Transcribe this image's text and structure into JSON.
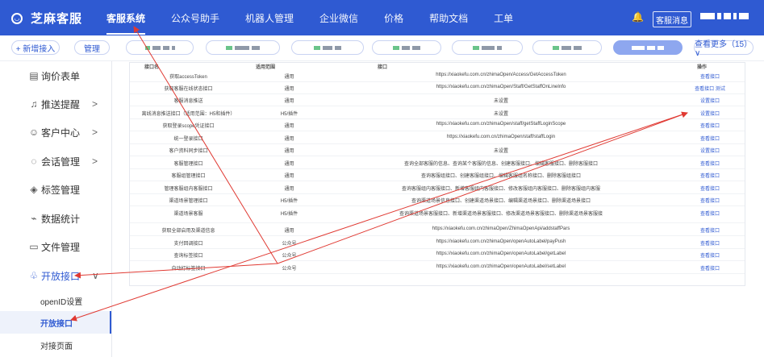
{
  "topbar": {
    "logo_glyph": "◡",
    "title": "芝麻客服",
    "nav": [
      "客服系统",
      "公众号助手",
      "机器人管理",
      "企业微信",
      "价格",
      "帮助文档",
      "工单"
    ],
    "bell_glyph": "🔔",
    "kf_button": "客服消息",
    "colors": {
      "brand": "#2f5ad2"
    }
  },
  "chipbar": {
    "add": "+ 新增接入",
    "manage": "管理",
    "more": "查看更多（15） ∨"
  },
  "sidebar": {
    "items": [
      {
        "label": "询价表单",
        "icon": "form-icon",
        "glyph": "▤",
        "arrow": ""
      },
      {
        "label": "推送提醒",
        "icon": "bell-icon",
        "glyph": "♫",
        "arrow": ">"
      },
      {
        "label": "客户中心",
        "icon": "user-icon",
        "glyph": "☺",
        "arrow": ">"
      },
      {
        "label": "会话管理",
        "icon": "chat-icon",
        "glyph": "◌",
        "arrow": ">"
      },
      {
        "label": "标签管理",
        "icon": "tag-icon",
        "glyph": "◈",
        "arrow": ""
      },
      {
        "label": "数据统计",
        "icon": "chart-icon",
        "glyph": "⌁",
        "arrow": ""
      },
      {
        "label": "文件管理",
        "icon": "folder-icon",
        "glyph": "▭",
        "arrow": ""
      },
      {
        "label": "开放接口",
        "icon": "api-icon",
        "glyph": "♧",
        "arrow": "∨"
      }
    ],
    "sub": [
      "openID设置",
      "开放接口",
      "对接页面"
    ]
  },
  "table": {
    "headers": [
      "接口名",
      "适用范围",
      "接口",
      "操作"
    ],
    "rows": [
      {
        "name": "获取accessToken",
        "scope": "通用",
        "url": "https://xiaokefu.com.cn/zhimaOpen/Access/GetAccessToken",
        "op": "查看接口"
      },
      {
        "name": "获取客服在线状态接口",
        "scope": "通用",
        "url": "https://xiaokefu.com.cn/zhimaOpen/Staff/GetStaffOnLineInfo",
        "op": "查看接口  测试"
      },
      {
        "name": "客服消息推送",
        "scope": "通用",
        "url": "未设置",
        "op": "设置接口"
      },
      {
        "name": "离线消息推送接口（适用范围：H5和插件）",
        "scope": "H5/插件",
        "url": "未设置",
        "op": "设置接口"
      },
      {
        "name": "获取登录scope凭证接口",
        "scope": "通用",
        "url": "https://xiaokefu.com.cn/zhimaOpen/staff/getStaffLoginScope",
        "op": "查看接口"
      },
      {
        "name": "统一登录接口",
        "scope": "通用",
        "url": "https://xiaokefu.com.cn/zhimaOpen/staff/staffLogin",
        "op": "查看接口"
      },
      {
        "name": "客户资料同步接口",
        "scope": "通用",
        "url": "未设置",
        "op": "设置接口"
      },
      {
        "name": "客服管理接口",
        "scope": "通用",
        "url": "查询全部客服的信息、查询某个客服的信息、创建客服接口、编辑客服接口、删除客服接口",
        "op": "查看接口"
      },
      {
        "name": "客服组管理接口",
        "scope": "通用",
        "url": "查询客服组接口、创建客服组接口、编辑客服组名称接口、删除客服组接口",
        "op": "查看接口"
      },
      {
        "name": "管理客服组内客服接口",
        "scope": "通用",
        "url": "查询客服组内客服接口、新增客服组内客服接口、修改客服组内客服接口、删除客服组内客服",
        "op": "查看接口"
      },
      {
        "name": "渠道场景管理接口",
        "scope": "H5/插件",
        "url": "查询渠道场景信息接口、创建渠道场景接口、编辑渠道场景接口、删除渠道场景接口",
        "op": "查看接口"
      },
      {
        "name": "渠道场景客服",
        "scope": "H5/插件",
        "url": "查询渠道场景客服接口、新增渠道场景客服接口、修改渠道场景客服接口、删除渠道场景客服接",
        "op": "查看接口"
      },
      {
        "name": "获取全部启用及渠道信息",
        "scope": "通用",
        "url": "https://xiaokefu.com.cn/zhimaOpen/ZhimaOpenApi/addstaffPars",
        "op": "查看接口"
      },
      {
        "name": "支付回调接口",
        "scope": "公众号",
        "url": "https://xiaokefu.com.cn/zhimaOpen/openAutoLabel/payPush",
        "op": "查看接口"
      },
      {
        "name": "查询标签接口",
        "scope": "公众号",
        "url": "https://xiaokefu.com.cn/zhimaOpen/openAutoLabel/getLabel",
        "op": "查看接口"
      },
      {
        "name": "自动打标签接口",
        "scope": "公众号",
        "url": "https://xiaokefu.com.cn/zhimaOpen/openAutoLabel/setLabel",
        "op": "查看接口"
      }
    ]
  },
  "annotations": {
    "arrow_color": "#e03a33"
  }
}
